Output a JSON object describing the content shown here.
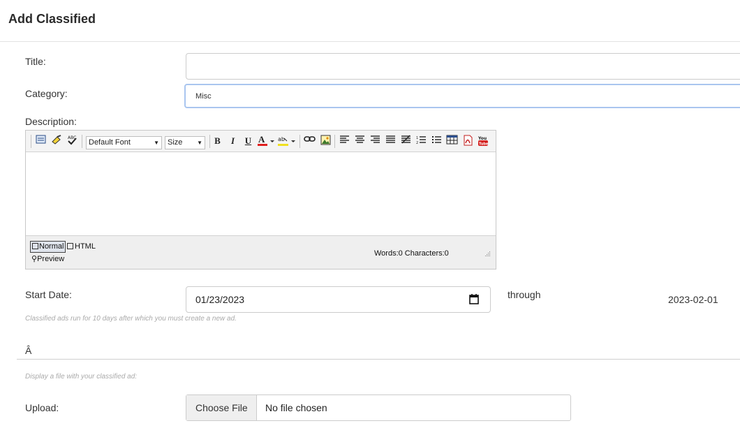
{
  "page_title": "Add Classified",
  "form": {
    "title_label": "Title:",
    "title_value": "",
    "category_label": "Category:",
    "category_value": "Misc",
    "description_label": "Description:",
    "editor": {
      "font_default": "Default Font",
      "size_default": "Size",
      "icons": [
        "spellcheck-page-icon",
        "clean-format-icon",
        "spell-check-abc-icon",
        "bold-icon",
        "italic-icon",
        "underline-icon",
        "font-color-icon",
        "highlight-color-icon",
        "link-icon",
        "image-icon",
        "align-left-icon",
        "align-center-icon",
        "align-right-icon",
        "justify-icon",
        "indent-icon",
        "numbered-list-icon",
        "bulleted-list-icon",
        "table-icon",
        "pdf-icon",
        "youtube-icon"
      ],
      "tab_normal": "Normal",
      "tab_html": "HTML",
      "tab_preview": "Preview",
      "word_count": "Words:0 Characters:0"
    },
    "start_date_label": "Start Date:",
    "start_date_value": "01/23/2023",
    "through_label": "through",
    "end_date": "2023-02-01",
    "start_hint": "Classified ads run for 10 days after which you must create a new ad.",
    "section_divider_text": "Â",
    "file_hint": "Display a file with your classified ad:",
    "upload_label": "Upload:",
    "choose_file_label": "Choose File",
    "no_file_label": "No file chosen"
  }
}
